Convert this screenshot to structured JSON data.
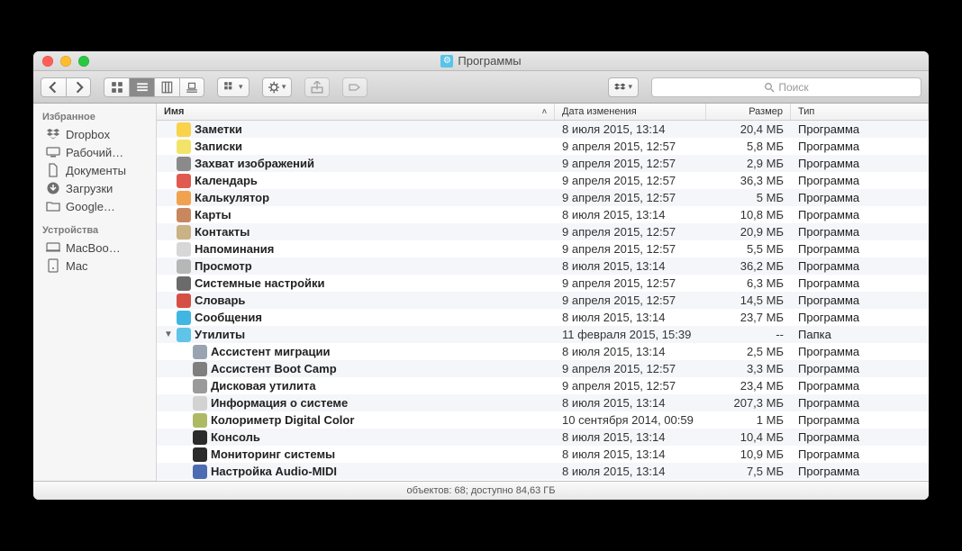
{
  "window": {
    "title": "Программы"
  },
  "toolbar": {
    "search_placeholder": "Поиск"
  },
  "sidebar": {
    "section_fav": "Избранное",
    "section_dev": "Устройства",
    "fav": [
      {
        "icon": "dropbox",
        "label": "Dropbox"
      },
      {
        "icon": "desktop",
        "label": "Рабочий…"
      },
      {
        "icon": "documents",
        "label": "Документы"
      },
      {
        "icon": "downloads",
        "label": "Загрузки"
      },
      {
        "icon": "folder",
        "label": "Google…"
      }
    ],
    "dev": [
      {
        "icon": "mac",
        "label": "MacBoo…"
      },
      {
        "icon": "disk",
        "label": "Mac"
      }
    ]
  },
  "columns": {
    "name": "Имя",
    "date": "Дата изменения",
    "size": "Размер",
    "kind": "Тип"
  },
  "rows": [
    {
      "indent": 0,
      "icon": "#f8d34b",
      "name": "Заметки",
      "date": "8 июля 2015, 13:14",
      "size": "20,4 МБ",
      "kind": "Программа"
    },
    {
      "indent": 0,
      "icon": "#f2e46a",
      "name": "Записки",
      "date": "9 апреля 2015, 12:57",
      "size": "5,8 МБ",
      "kind": "Программа"
    },
    {
      "indent": 0,
      "icon": "#8a8a8a",
      "name": "Захват изображений",
      "date": "9 апреля 2015, 12:57",
      "size": "2,9 МБ",
      "kind": "Программа"
    },
    {
      "indent": 0,
      "icon": "#e15a4f",
      "name": "Календарь",
      "date": "9 апреля 2015, 12:57",
      "size": "36,3 МБ",
      "kind": "Программа"
    },
    {
      "indent": 0,
      "icon": "#f0a24e",
      "name": "Калькулятор",
      "date": "9 апреля 2015, 12:57",
      "size": "5 МБ",
      "kind": "Программа"
    },
    {
      "indent": 0,
      "icon": "#c9875f",
      "name": "Карты",
      "date": "8 июля 2015, 13:14",
      "size": "10,8 МБ",
      "kind": "Программа"
    },
    {
      "indent": 0,
      "icon": "#c9b284",
      "name": "Контакты",
      "date": "9 апреля 2015, 12:57",
      "size": "20,9 МБ",
      "kind": "Программа"
    },
    {
      "indent": 0,
      "icon": "#d7d7d7",
      "name": "Напоминания",
      "date": "9 апреля 2015, 12:57",
      "size": "5,5 МБ",
      "kind": "Программа"
    },
    {
      "indent": 0,
      "icon": "#b7b7b7",
      "name": "Просмотр",
      "date": "8 июля 2015, 13:14",
      "size": "36,2 МБ",
      "kind": "Программа"
    },
    {
      "indent": 0,
      "icon": "#6b6b6b",
      "name": "Системные настройки",
      "date": "9 апреля 2015, 12:57",
      "size": "6,3 МБ",
      "kind": "Программа"
    },
    {
      "indent": 0,
      "icon": "#d64f44",
      "name": "Словарь",
      "date": "9 апреля 2015, 12:57",
      "size": "14,5 МБ",
      "kind": "Программа"
    },
    {
      "indent": 0,
      "icon": "#3fb7e2",
      "name": "Сообщения",
      "date": "8 июля 2015, 13:14",
      "size": "23,7 МБ",
      "kind": "Программа"
    },
    {
      "indent": 0,
      "expanded": true,
      "icon": "#5fc4e8",
      "name": "Утилиты",
      "date": "11 февраля 2015, 15:39",
      "size": "--",
      "kind": "Папка"
    },
    {
      "indent": 1,
      "icon": "#9aa4b0",
      "name": "Ассистент миграции",
      "date": "8 июля 2015, 13:14",
      "size": "2,5 МБ",
      "kind": "Программа"
    },
    {
      "indent": 1,
      "icon": "#7f7f7f",
      "name": "Ассистент Boot Camp",
      "date": "9 апреля 2015, 12:57",
      "size": "3,3 МБ",
      "kind": "Программа"
    },
    {
      "indent": 1,
      "icon": "#9a9a9a",
      "name": "Дисковая утилита",
      "date": "9 апреля 2015, 12:57",
      "size": "23,4 МБ",
      "kind": "Программа"
    },
    {
      "indent": 1,
      "icon": "#d2d2d2",
      "name": "Информация о системе",
      "date": "8 июля 2015, 13:14",
      "size": "207,3 МБ",
      "kind": "Программа"
    },
    {
      "indent": 1,
      "icon": "#aeb964",
      "name": "Колориметр Digital Color",
      "date": "10 сентября 2014, 00:59",
      "size": "1 МБ",
      "kind": "Программа"
    },
    {
      "indent": 1,
      "icon": "#2b2b2b",
      "name": "Консоль",
      "date": "8 июля 2015, 13:14",
      "size": "10,4 МБ",
      "kind": "Программа"
    },
    {
      "indent": 1,
      "icon": "#2b2b2b",
      "name": "Мониторинг системы",
      "date": "8 июля 2015, 13:14",
      "size": "10,9 МБ",
      "kind": "Программа"
    },
    {
      "indent": 1,
      "icon": "#4c6bb0",
      "name": "Настройка Audio-MIDI",
      "date": "8 июля 2015, 13:14",
      "size": "7,5 МБ",
      "kind": "Программа"
    }
  ],
  "status": "объектов: 68; доступно 84,63 ГБ"
}
